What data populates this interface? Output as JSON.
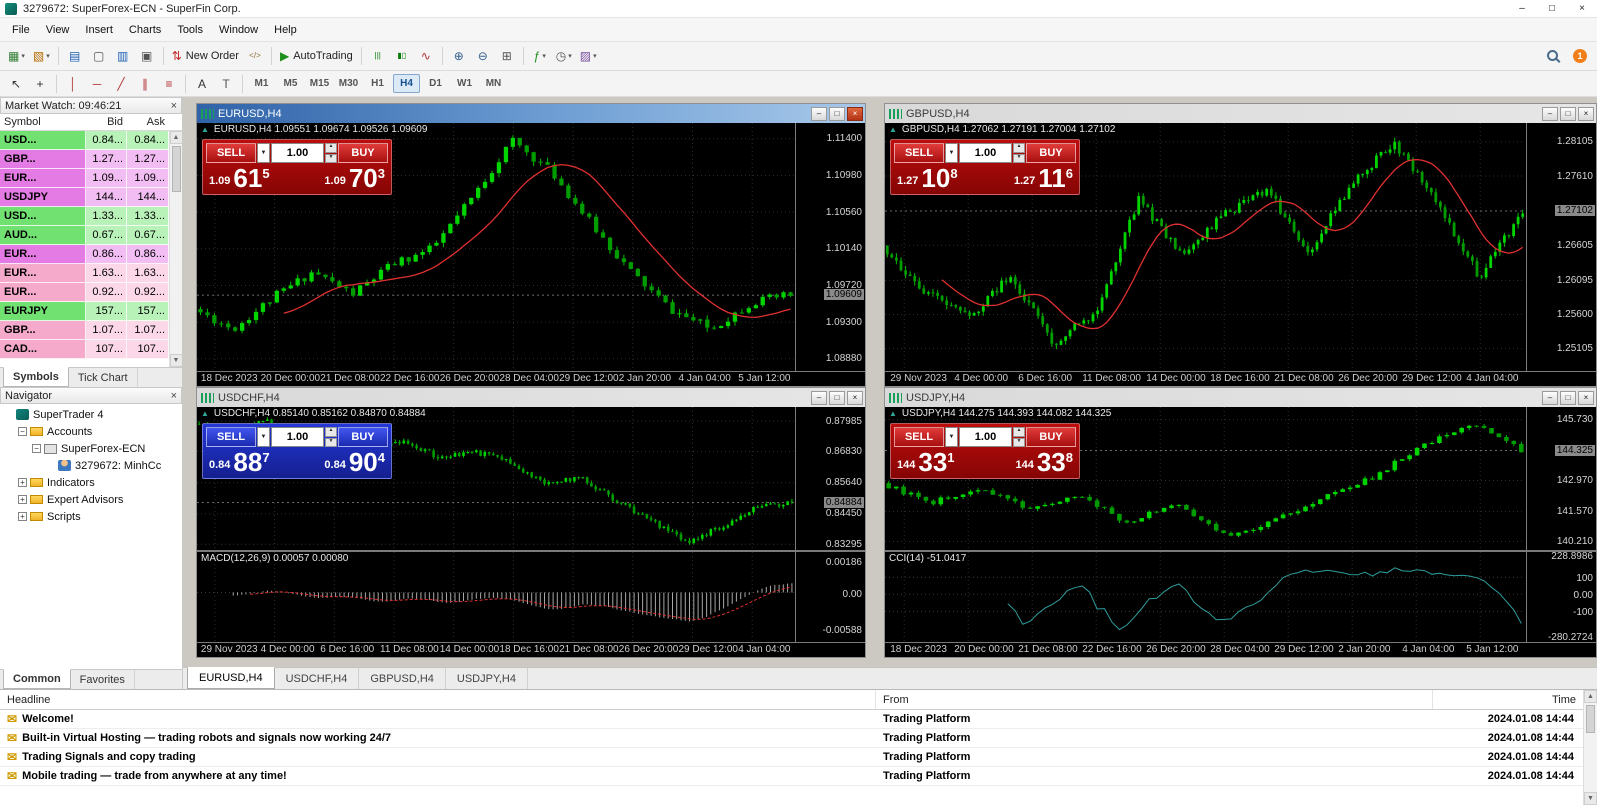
{
  "titlebar": {
    "title": "3279672: SuperForex-ECN - SuperFin Corp.",
    "controls": {
      "minimize": "–",
      "maximize": "□",
      "close": "×"
    }
  },
  "menu": [
    "File",
    "View",
    "Insert",
    "Charts",
    "Tools",
    "Window",
    "Help"
  ],
  "toolbar_main": {
    "items": [
      {
        "icon": "new-chart",
        "dropdown": true
      },
      {
        "icon": "profiles",
        "dropdown": true
      },
      {
        "sep": true
      },
      {
        "icon": "market-watch"
      },
      {
        "icon": "data-window"
      },
      {
        "icon": "navigator"
      },
      {
        "icon": "terminal"
      },
      {
        "sep": true
      },
      {
        "icon": "new-order",
        "label": "New Order"
      },
      {
        "icon": "metaeditor"
      },
      {
        "sep": true
      },
      {
        "icon": "autotrading",
        "label": "AutoTrading"
      },
      {
        "sep": true
      },
      {
        "icon": "bar-chart"
      },
      {
        "icon": "candle-chart"
      },
      {
        "icon": "line-chart"
      },
      {
        "sep": true
      },
      {
        "icon": "zoom-in"
      },
      {
        "icon": "zoom-out"
      },
      {
        "icon": "tile-windows"
      },
      {
        "sep": true
      },
      {
        "icon": "indicators",
        "dropdown": true
      },
      {
        "icon": "periods",
        "dropdown": true
      },
      {
        "icon": "templates",
        "dropdown": true
      }
    ],
    "badge": "1"
  },
  "toolbar_tools": [
    {
      "icon": "cursor"
    },
    {
      "icon": "crosshair"
    },
    {
      "sep": true
    },
    {
      "icon": "vertical-line"
    },
    {
      "icon": "horizontal-line"
    },
    {
      "icon": "trendline"
    },
    {
      "icon": "equidistant-channel"
    },
    {
      "icon": "fibonacci"
    },
    {
      "sep": true
    },
    {
      "icon": "text"
    },
    {
      "icon": "text-label"
    },
    {
      "sep": true
    }
  ],
  "timeframes": {
    "items": [
      "M1",
      "M5",
      "M15",
      "M30",
      "H1",
      "H4",
      "D1",
      "W1",
      "MN"
    ],
    "active": "H4"
  },
  "market_watch": {
    "title": "Market Watch: 09:46:21",
    "columns": [
      "Symbol",
      "Bid",
      "Ask"
    ],
    "rows": [
      {
        "symbol": "USD...",
        "bid": "0.84...",
        "ask": "0.84...",
        "tone": "green"
      },
      {
        "symbol": "GBP...",
        "bid": "1.27...",
        "ask": "1.27...",
        "tone": "magenta"
      },
      {
        "symbol": "EUR...",
        "bid": "1.09...",
        "ask": "1.09...",
        "tone": "magenta"
      },
      {
        "symbol": "USDJPY",
        "bid": "144...",
        "ask": "144...",
        "tone": "magenta"
      },
      {
        "symbol": "USD...",
        "bid": "1.33...",
        "ask": "1.33...",
        "tone": "green"
      },
      {
        "symbol": "AUD...",
        "bid": "0.67...",
        "ask": "0.67...",
        "tone": "green"
      },
      {
        "symbol": "EUR...",
        "bid": "0.86...",
        "ask": "0.86...",
        "tone": "magenta"
      },
      {
        "symbol": "EUR...",
        "bid": "1.63...",
        "ask": "1.63...",
        "tone": "pink"
      },
      {
        "symbol": "EUR...",
        "bid": "0.92...",
        "ask": "0.92...",
        "tone": "pink"
      },
      {
        "symbol": "EURJPY",
        "bid": "157...",
        "ask": "157...",
        "tone": "green"
      },
      {
        "symbol": "GBP...",
        "bid": "1.07...",
        "ask": "1.07...",
        "tone": "pink"
      },
      {
        "symbol": "CAD...",
        "bid": "107...",
        "ask": "107...",
        "tone": "pink"
      }
    ],
    "tabs": {
      "items": [
        "Symbols",
        "Tick Chart"
      ],
      "active": "Symbols"
    }
  },
  "navigator": {
    "title": "Navigator",
    "tree": [
      {
        "label": "SuperTrader 4",
        "depth": 0,
        "icon": "app",
        "expander": ""
      },
      {
        "label": "Accounts",
        "depth": 1,
        "icon": "folder",
        "expander": "minus"
      },
      {
        "label": "SuperForex-ECN",
        "depth": 2,
        "icon": "server",
        "expander": "minus"
      },
      {
        "label": "3279672: MinhCc",
        "depth": 3,
        "icon": "account",
        "expander": ""
      },
      {
        "label": "Indicators",
        "depth": 1,
        "icon": "folder",
        "expander": "plus"
      },
      {
        "label": "Expert Advisors",
        "depth": 1,
        "icon": "folder",
        "expander": "plus"
      },
      {
        "label": "Scripts",
        "depth": 1,
        "icon": "folder",
        "expander": "plus"
      }
    ],
    "tabs": {
      "items": [
        "Common",
        "Favorites"
      ],
      "active": "Common"
    }
  },
  "charts": [
    {
      "symbol": "EURUSD",
      "title": "EURUSD,H4",
      "active": true,
      "theme": "red",
      "ohlc": "EURUSD,H4  1.09551 1.09674 1.09526 1.09609",
      "one_click": {
        "sell_label": "SELL",
        "buy_label": "BUY",
        "volume": "1.00",
        "sell_price": {
          "small": "1.09",
          "big": "61",
          "sup": "5"
        },
        "buy_price": {
          "small": "1.09",
          "big": "70",
          "sup": "3"
        }
      },
      "axis": {
        "labels": [
          "1.11400",
          "1.10980",
          "1.10560",
          "1.10140",
          "1.09720",
          "1.09300",
          "1.08880"
        ],
        "current": "1.09609",
        "min": 1.0874,
        "max": 1.1158
      },
      "dates": [
        "18 Dec 2023",
        "20 Dec 00:00",
        "21 Dec 08:00",
        "22 Dec 16:00",
        "26 Dec 20:00",
        "28 Dec 04:00",
        "29 Dec 12:00",
        "2 Jan 20:00",
        "4 Jan 04:00",
        "5 Jan 12:00"
      ],
      "series": {
        "keys": [
          1.0945,
          1.0922,
          1.0958,
          1.0988,
          1.0962,
          1.0996,
          1.1014,
          1.1072,
          1.1138,
          1.1102,
          1.1042,
          1.0987,
          1.0944,
          1.0922,
          1.0952,
          1.0961
        ],
        "candles": 86,
        "seed": 11,
        "ma": true
      },
      "indicator": null
    },
    {
      "symbol": "GBPUSD",
      "title": "GBPUSD,H4",
      "active": false,
      "theme": "red",
      "ohlc": "GBPUSD,H4  1.27062 1.27191 1.27004 1.27102",
      "one_click": {
        "sell_label": "SELL",
        "buy_label": "BUY",
        "volume": "1.00",
        "sell_price": {
          "small": "1.27",
          "big": "10",
          "sup": "8"
        },
        "buy_price": {
          "small": "1.27",
          "big": "11",
          "sup": "6"
        }
      },
      "axis": {
        "labels": [
          "1.28105",
          "1.27610",
          "1.26605",
          "1.26095",
          "1.25600",
          "1.25105"
        ],
        "current": "1.27102",
        "min": 1.2478,
        "max": 1.2838
      },
      "dates": [
        "29 Nov 2023",
        "4 Dec 00:00",
        "6 Dec 16:00",
        "11 Dec 08:00",
        "14 Dec 00:00",
        "18 Dec 16:00",
        "21 Dec 08:00",
        "26 Dec 20:00",
        "29 Dec 12:00",
        "4 Jan 04:00"
      ],
      "series": {
        "keys": [
          1.266,
          1.2592,
          1.2555,
          1.2618,
          1.2518,
          1.2565,
          1.2728,
          1.2645,
          1.2705,
          1.2742,
          1.2652,
          1.2752,
          1.2808,
          1.2722,
          1.2614,
          1.271
        ],
        "candles": 140,
        "seed": 23,
        "ma": true
      },
      "indicator": null
    },
    {
      "symbol": "USDCHF",
      "title": "USDCHF,H4",
      "active": false,
      "theme": "blue",
      "ohlc": "USDCHF,H4  0.85140 0.85162 0.84870 0.84884",
      "one_click": {
        "sell_label": "SELL",
        "buy_label": "BUY",
        "volume": "1.00",
        "sell_price": {
          "small": "0.84",
          "big": "88",
          "sup": "7"
        },
        "buy_price": {
          "small": "0.84",
          "big": "90",
          "sup": "4"
        }
      },
      "axis": {
        "labels": [
          "0.87985",
          "0.86830",
          "0.85640",
          "0.84450",
          "0.83295"
        ],
        "current": "0.84884",
        "min": 0.8308,
        "max": 0.8852
      },
      "dates": [
        "29 Nov 2023",
        "4 Dec 00:00",
        "6 Dec 16:00",
        "11 Dec 08:00",
        "14 Dec 00:00",
        "18 Dec 16:00",
        "21 Dec 08:00",
        "26 Dec 20:00",
        "29 Dec 12:00",
        "4 Jan 04:00"
      ],
      "series": {
        "keys": [
          0.8788,
          0.8758,
          0.8798,
          0.8744,
          0.8757,
          0.8704,
          0.8716,
          0.8658,
          0.8682,
          0.8638,
          0.8564,
          0.8579,
          0.8498,
          0.8418,
          0.8336,
          0.8396,
          0.847,
          0.8488
        ],
        "candles": 140,
        "seed": 37,
        "ma": false
      },
      "indicator": {
        "type": "macd",
        "label": "MACD(12,26,9) 0.00057 0.00080",
        "axis": [
          "0.00186",
          "0.00",
          "-0.00588"
        ]
      }
    },
    {
      "symbol": "USDJPY",
      "title": "USDJPY,H4",
      "active": false,
      "theme": "red",
      "ohlc": "USDJPY,H4  144.275 144.393 144.082 144.325",
      "one_click": {
        "sell_label": "SELL",
        "buy_label": "BUY",
        "volume": "1.00",
        "sell_price": {
          "small": "144",
          "big": "33",
          "sup": "1"
        },
        "buy_price": {
          "small": "144",
          "big": "33",
          "sup": "8"
        }
      },
      "axis": {
        "labels": [
          "145.730",
          "142.970",
          "141.570",
          "140.210"
        ],
        "current": "144.325",
        "min": 139.82,
        "max": 146.3
      },
      "dates": [
        "18 Dec 2023",
        "20 Dec 00:00",
        "21 Dec 08:00",
        "22 Dec 16:00",
        "26 Dec 20:00",
        "28 Dec 04:00",
        "29 Dec 12:00",
        "2 Jan 20:00",
        "4 Jan 04:00",
        "5 Jan 12:00"
      ],
      "series": {
        "keys": [
          142.85,
          141.95,
          142.65,
          141.65,
          142.35,
          141.05,
          141.95,
          140.45,
          141.15,
          142.25,
          143.15,
          144.55,
          145.62,
          144.33
        ],
        "candles": 86,
        "seed": 53,
        "ma": false
      },
      "indicator": {
        "type": "cci",
        "label": "CCI(14) -51.0417",
        "axis": [
          "228.8986",
          "100",
          "0.00",
          "-100",
          "-280.2724"
        ]
      }
    }
  ],
  "chart_tabs": {
    "items": [
      "EURUSD,H4",
      "USDCHF,H4",
      "GBPUSD,H4",
      "USDJPY,H4"
    ],
    "active": "EURUSD,H4"
  },
  "terminal": {
    "columns": [
      "Headline",
      "From",
      "Time"
    ],
    "rows": [
      {
        "headline": "Welcome!",
        "from": "Trading Platform",
        "time": "2024.01.08 14:44"
      },
      {
        "headline": "Built-in Virtual Hosting — trading robots and signals now working 24/7",
        "from": "Trading Platform",
        "time": "2024.01.08 14:44"
      },
      {
        "headline": "Trading Signals and copy trading",
        "from": "Trading Platform",
        "time": "2024.01.08 14:44"
      },
      {
        "headline": "Mobile trading — trade from anywhere at any time!",
        "from": "Trading Platform",
        "time": "2024.01.08 14:44"
      }
    ]
  }
}
